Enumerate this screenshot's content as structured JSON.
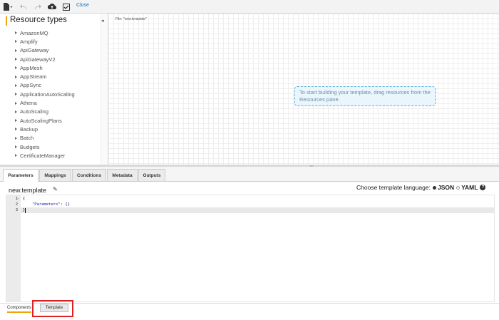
{
  "toolbar": {
    "close_label": "Close",
    "icons": [
      "new-file-icon",
      "undo-icon",
      "redo-icon",
      "upload-icon",
      "validate-icon"
    ]
  },
  "sidebar": {
    "title": "Resource types",
    "items": [
      {
        "label": "AmazonMQ"
      },
      {
        "label": "Amplify"
      },
      {
        "label": "ApiGateway"
      },
      {
        "label": "ApiGatewayV2"
      },
      {
        "label": "AppMesh"
      },
      {
        "label": "AppStream"
      },
      {
        "label": "AppSync"
      },
      {
        "label": "ApplicationAutoScaling"
      },
      {
        "label": "Athena"
      },
      {
        "label": "AutoScaling"
      },
      {
        "label": "AutoScalingPlans"
      },
      {
        "label": "Backup"
      },
      {
        "label": "Batch"
      },
      {
        "label": "Budgets"
      },
      {
        "label": "CertificateManager"
      }
    ]
  },
  "canvas": {
    "file_label": "File: \"new.template\"",
    "hint": "To start building your template, drag resources from the Resources pane."
  },
  "tabs": [
    {
      "label": "Parameters",
      "active": true
    },
    {
      "label": "Mappings"
    },
    {
      "label": "Conditions"
    },
    {
      "label": "Metadata"
    },
    {
      "label": "Outputs"
    }
  ],
  "editor": {
    "filename": "new.template",
    "language_prompt": "Choose template language:",
    "languages": [
      {
        "label": "JSON",
        "selected": true
      },
      {
        "label": "YAML",
        "selected": false
      }
    ],
    "line_numbers": [
      "1",
      "2",
      "3"
    ],
    "fold_marker": "-",
    "lines": [
      "{",
      "\"Parameters\": {}",
      "}"
    ]
  },
  "bottom_tabs": {
    "components": "Components",
    "template": "Template"
  },
  "colors": {
    "accent": "#f0a30a",
    "link": "#1a6fb8",
    "highlight": "#e02020",
    "hint_border": "#5bb0dd"
  }
}
